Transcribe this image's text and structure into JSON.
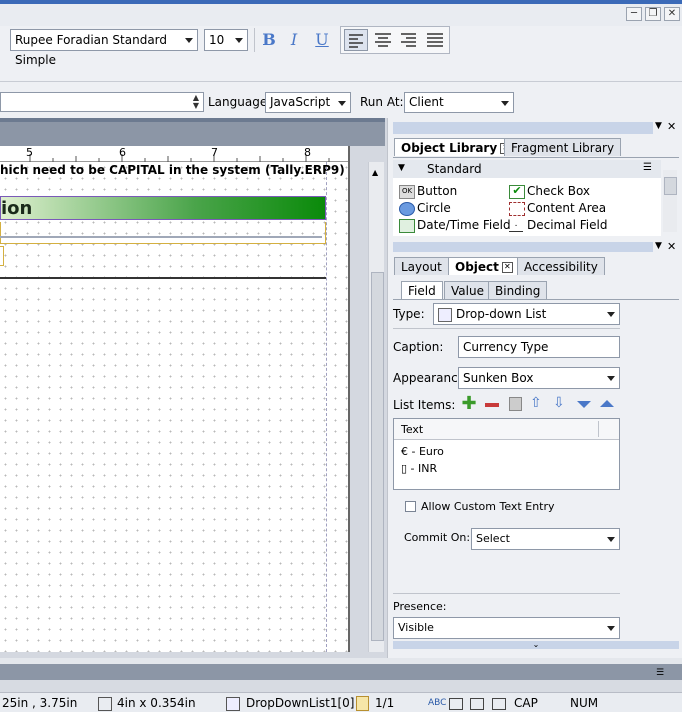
{
  "window": {
    "minimize": "─",
    "restore": "❐",
    "close": "✕"
  },
  "format_toolbar": {
    "font_family": "Rupee Foradian Standard Simple",
    "font_size": "10",
    "bold": "B",
    "italic": "I",
    "underline": "U"
  },
  "script_toolbar": {
    "language_label": "Language:",
    "language_value": "JavaScript",
    "run_at_label": "Run At:",
    "run_at_value": "Client"
  },
  "ruler": {
    "ticks": [
      "5",
      "6",
      "7",
      "8"
    ]
  },
  "canvas": {
    "text_line": "hich need to be CAPITAL in the system (Tally.ERP9)",
    "banner_text": "ion"
  },
  "object_library": {
    "tabs": [
      {
        "label": "Object Library"
      },
      {
        "label": "Fragment Library"
      }
    ],
    "group": "Standard",
    "items": [
      {
        "label": "Button",
        "icon": "button-icon"
      },
      {
        "label": "Check Box",
        "icon": "checkbox-icon"
      },
      {
        "label": "Circle",
        "icon": "circle-icon"
      },
      {
        "label": "Content Area",
        "icon": "content-area-icon"
      },
      {
        "label": "Date/Time Field",
        "icon": "datetime-icon"
      },
      {
        "label": "Decimal Field",
        "icon": "decimal-icon"
      }
    ]
  },
  "object_palette": {
    "tabs": [
      {
        "label": "Layout"
      },
      {
        "label": "Object"
      },
      {
        "label": "Accessibility"
      }
    ],
    "subtabs": [
      {
        "label": "Field"
      },
      {
        "label": "Value"
      },
      {
        "label": "Binding"
      }
    ],
    "type_label": "Type:",
    "type_value": "Drop-down List",
    "caption_label": "Caption:",
    "caption_value": "Currency Type",
    "appearance_label": "Appearance:",
    "appearance_value": "Sunken Box",
    "list_items_label": "List Items:",
    "list_header": "Text",
    "list_items": [
      "€ - Euro",
      "▯ - INR"
    ],
    "allow_custom_label": "Allow Custom Text Entry",
    "commit_on_label": "Commit On:",
    "commit_on_value": "Select",
    "presence_label": "Presence:",
    "presence_value": "Visible"
  },
  "status": {
    "position": "25in , 3.75in",
    "size": "4in x 0.354in",
    "object": "DropDownList1[0]",
    "page": "1/1",
    "cap": "CAP",
    "num": "NUM"
  },
  "colors": {
    "banner_start": "#dff0d0",
    "banner_end": "#0a8a0a",
    "accent": "#3b6ab8"
  }
}
